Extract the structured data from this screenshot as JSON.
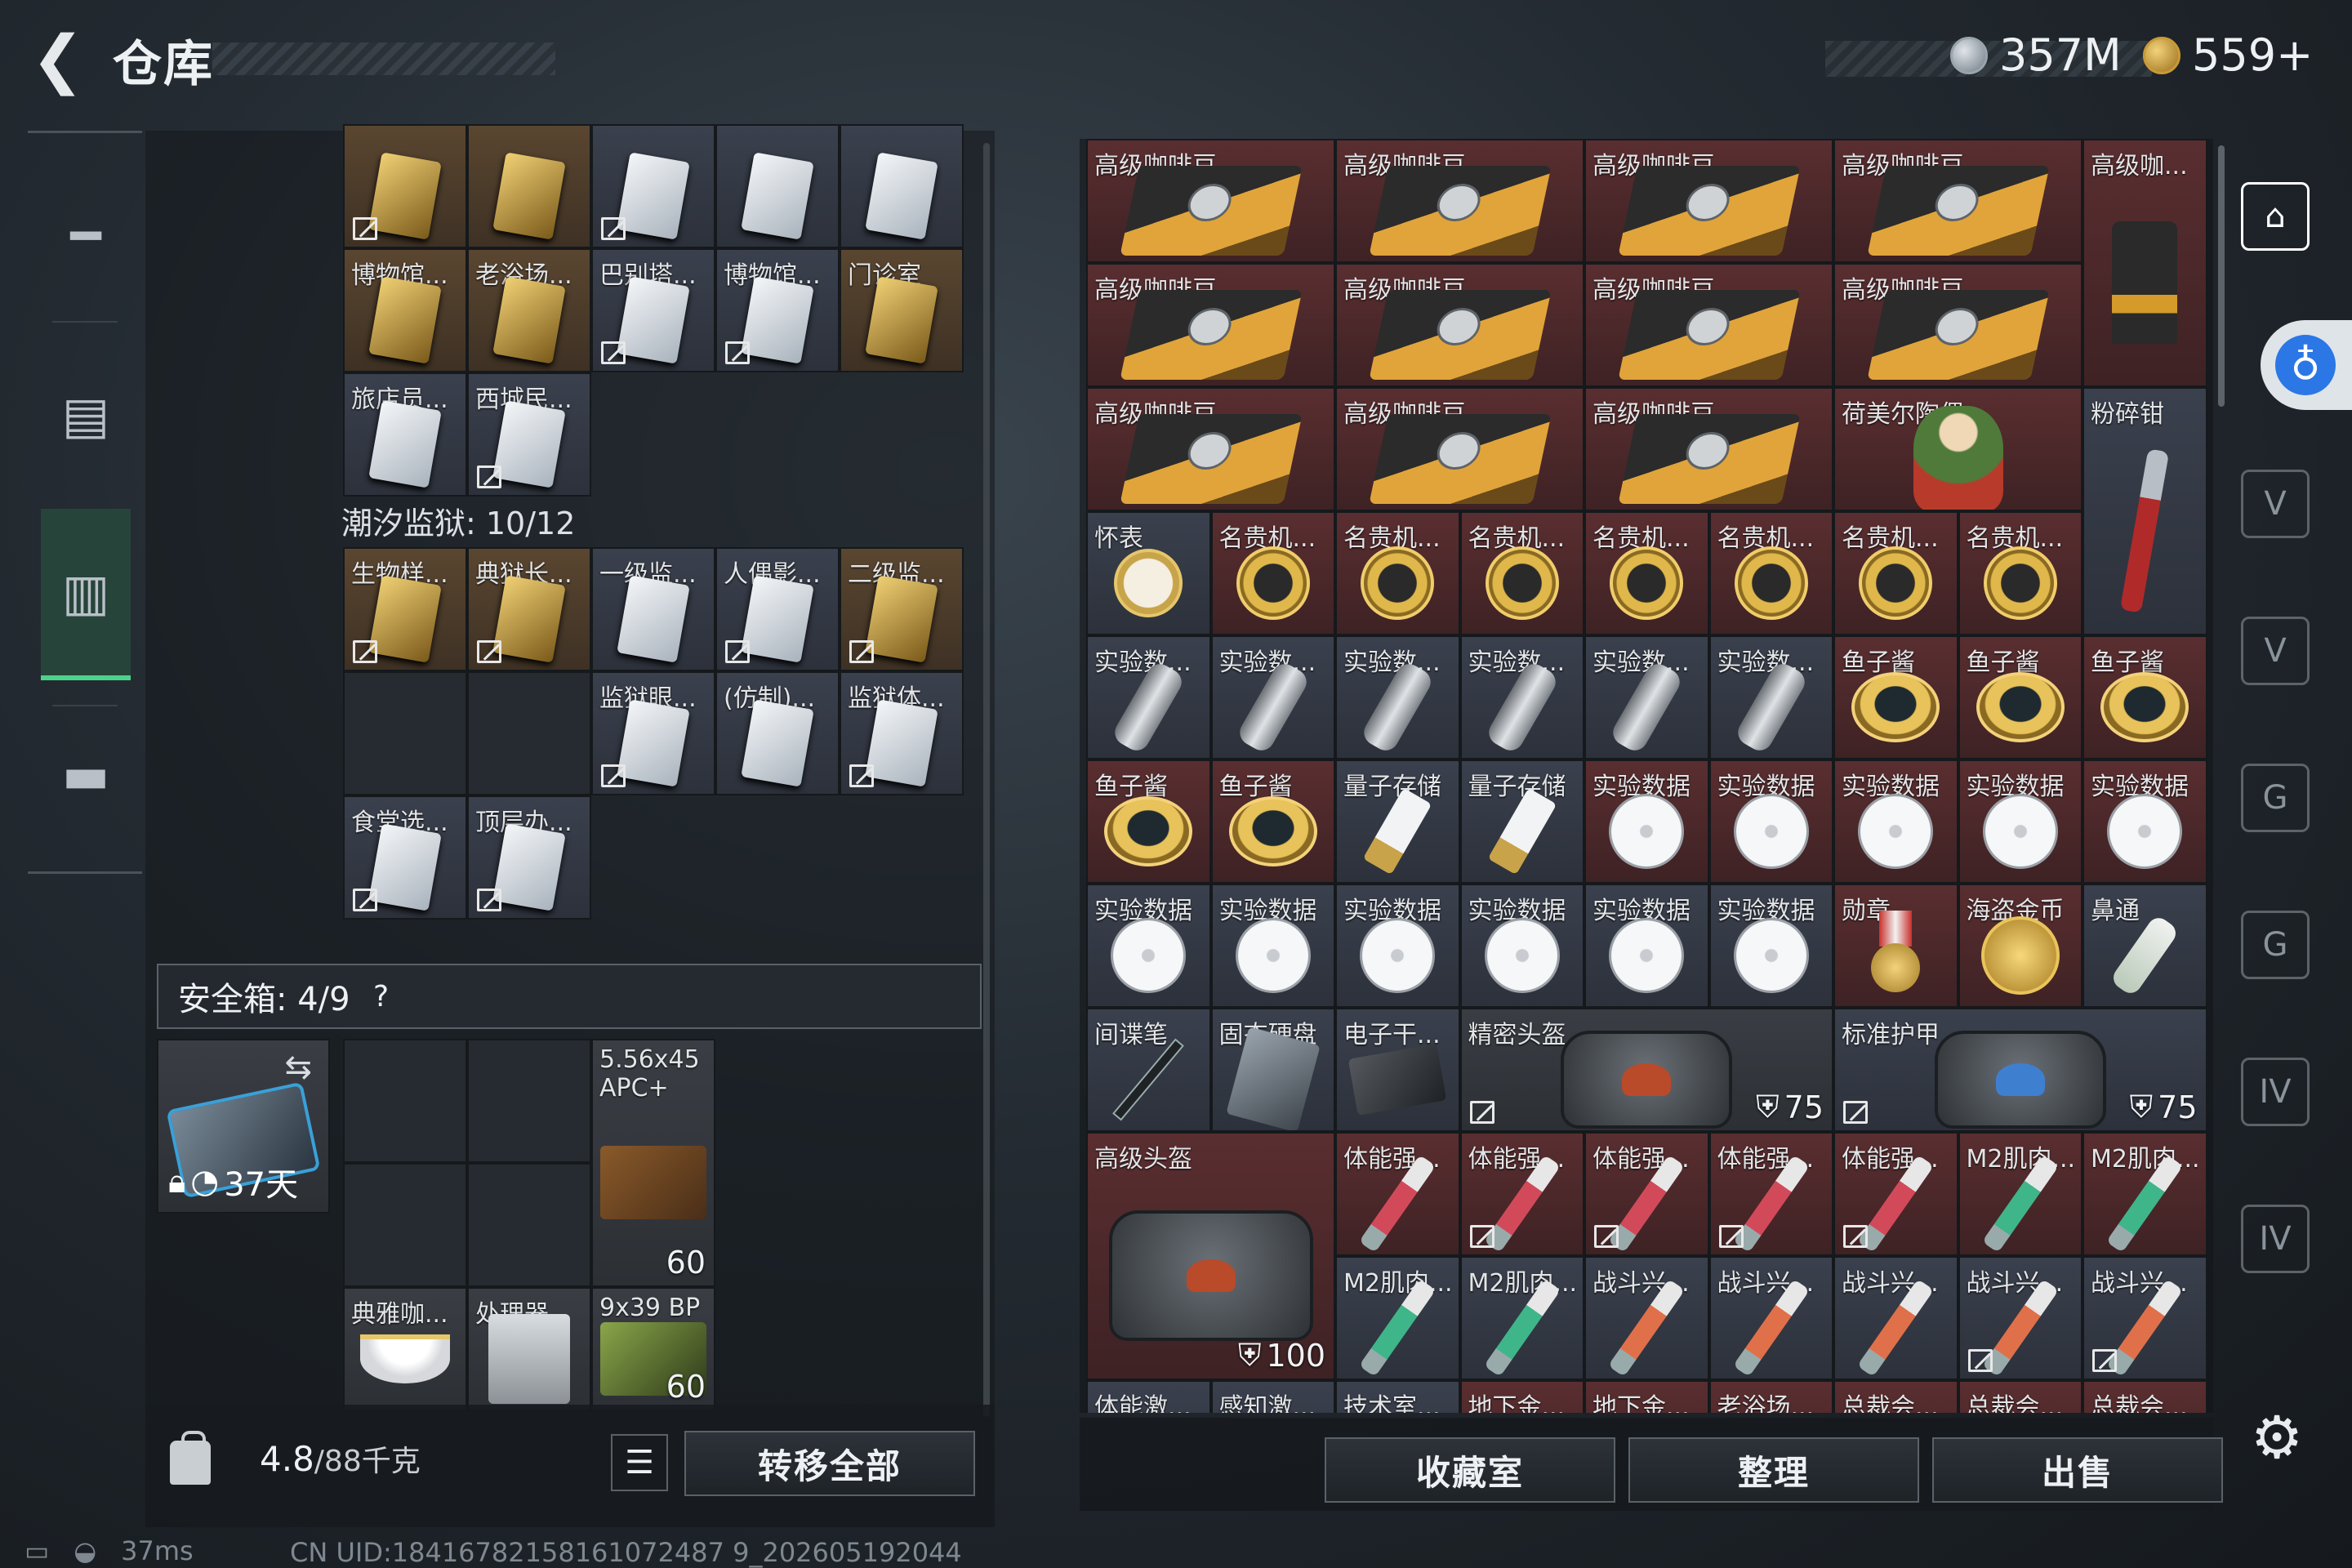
{
  "header": {
    "title": "仓库",
    "currency_silver": "357M",
    "currency_gold": "559+"
  },
  "left": {
    "tidal_prison_label": "潮汐监狱: 10/12",
    "safe_box_label": "安全箱: 4/9",
    "safe_help": "?",
    "safe_case_days": "37天",
    "weight_value": "4.8",
    "weight_max": "/88千克",
    "transfer_all": "转移全部",
    "grid_cards": [
      {
        "label": "",
        "tone": "gold",
        "found": true
      },
      {
        "label": "",
        "tone": "gold",
        "found": false
      },
      {
        "label": "",
        "tone": "blue",
        "found": true
      },
      {
        "label": "",
        "tone": "blue",
        "found": false
      },
      {
        "label": "",
        "tone": "blue",
        "found": false
      },
      {
        "label": "博物馆...",
        "tone": "gold",
        "found": false
      },
      {
        "label": "老浴场...",
        "tone": "gold",
        "found": false
      },
      {
        "label": "巴别塔...",
        "tone": "blue",
        "found": true
      },
      {
        "label": "博物馆...",
        "tone": "blue",
        "found": true
      },
      {
        "label": "门诊室",
        "tone": "gold",
        "found": false
      },
      {
        "label": "旅店员...",
        "tone": "blue",
        "found": false
      },
      {
        "label": "西城民...",
        "tone": "blue",
        "found": true
      }
    ],
    "prison_cards": [
      {
        "label": "生物样...",
        "tone": "gold",
        "found": true
      },
      {
        "label": "典狱长...",
        "tone": "gold",
        "found": true
      },
      {
        "label": "一级监...",
        "tone": "blue",
        "found": false
      },
      {
        "label": "人偶影...",
        "tone": "blue",
        "found": true
      },
      {
        "label": "二级监...",
        "tone": "gold",
        "found": true
      },
      {
        "label": "监狱眼...",
        "tone": "blue",
        "found": true
      },
      {
        "label": "(仿制)...",
        "tone": "blue",
        "found": false
      },
      {
        "label": "监狱体...",
        "tone": "blue",
        "found": true
      },
      {
        "label": "食堂选...",
        "tone": "blue",
        "found": true
      },
      {
        "label": "顶层办...",
        "tone": "blue",
        "found": true
      }
    ],
    "safe_items": [
      {
        "label": "5.56x45 APC+",
        "count": "60"
      },
      {
        "label": "典雅咖...",
        "count": ""
      },
      {
        "label": "处理器",
        "count": ""
      },
      {
        "label": "9x39 BP",
        "count": "60"
      }
    ]
  },
  "right": {
    "items": [
      {
        "label": "高级咖啡豆",
        "icon": "coffee-icon"
      },
      {
        "label": "高级咖...",
        "icon": "coffee-bag-icon"
      },
      {
        "label": "荷美尔陶偶",
        "icon": "figurine-icon"
      },
      {
        "label": "粉碎钳",
        "icon": "pliers-icon"
      },
      {
        "label": "怀表",
        "icon": "pocket-watch-icon"
      },
      {
        "label": "名贵机...",
        "icon": "watch-icon"
      },
      {
        "label": "实验数...",
        "icon": "vial-icon"
      },
      {
        "label": "鱼子酱",
        "icon": "caviar-icon"
      },
      {
        "label": "量子存储",
        "icon": "usb-icon"
      },
      {
        "label": "实验数据",
        "icon": "disc-icon"
      },
      {
        "label": "勋章",
        "icon": "medal-icon"
      },
      {
        "label": "海盗金币",
        "icon": "gold-coin-icon"
      },
      {
        "label": "鼻通",
        "icon": "inhaler-icon"
      },
      {
        "label": "间谍笔",
        "icon": "pen-icon"
      },
      {
        "label": "固态硬盘",
        "icon": "ssd-icon"
      },
      {
        "label": "电子干...",
        "icon": "device-icon"
      },
      {
        "label": "精密头盔",
        "icon": "helmet-icon",
        "durability": "75"
      },
      {
        "label": "标准护甲",
        "icon": "armor-icon",
        "durability": "75"
      },
      {
        "label": "高级头盔",
        "icon": "helmet-icon",
        "durability": "100"
      },
      {
        "label": "体能强...",
        "icon": "syringe-icon"
      },
      {
        "label": "M2肌肉...",
        "icon": "syringe-icon"
      },
      {
        "label": "战斗兴...",
        "icon": "syringe-icon"
      }
    ],
    "cutoff_row": [
      "体能激...",
      "感知激...",
      "技术室...",
      "地下金...",
      "地下金...",
      "老浴场...",
      "总裁会...",
      "总裁会...",
      "总裁会..."
    ],
    "buttons": {
      "collection": "收藏室",
      "sort": "整理",
      "sell": "出售"
    }
  },
  "status": {
    "ping": "37ms",
    "uid": "CN UID:18416782158161072487 9_202605192044"
  },
  "colors": {
    "accent_green": "#4dd28b",
    "rarity_gold": "#5a4630",
    "rarity_blue": "#3a404d",
    "rarity_red": "#5a2e30",
    "access_blue": "#2b77e6"
  }
}
